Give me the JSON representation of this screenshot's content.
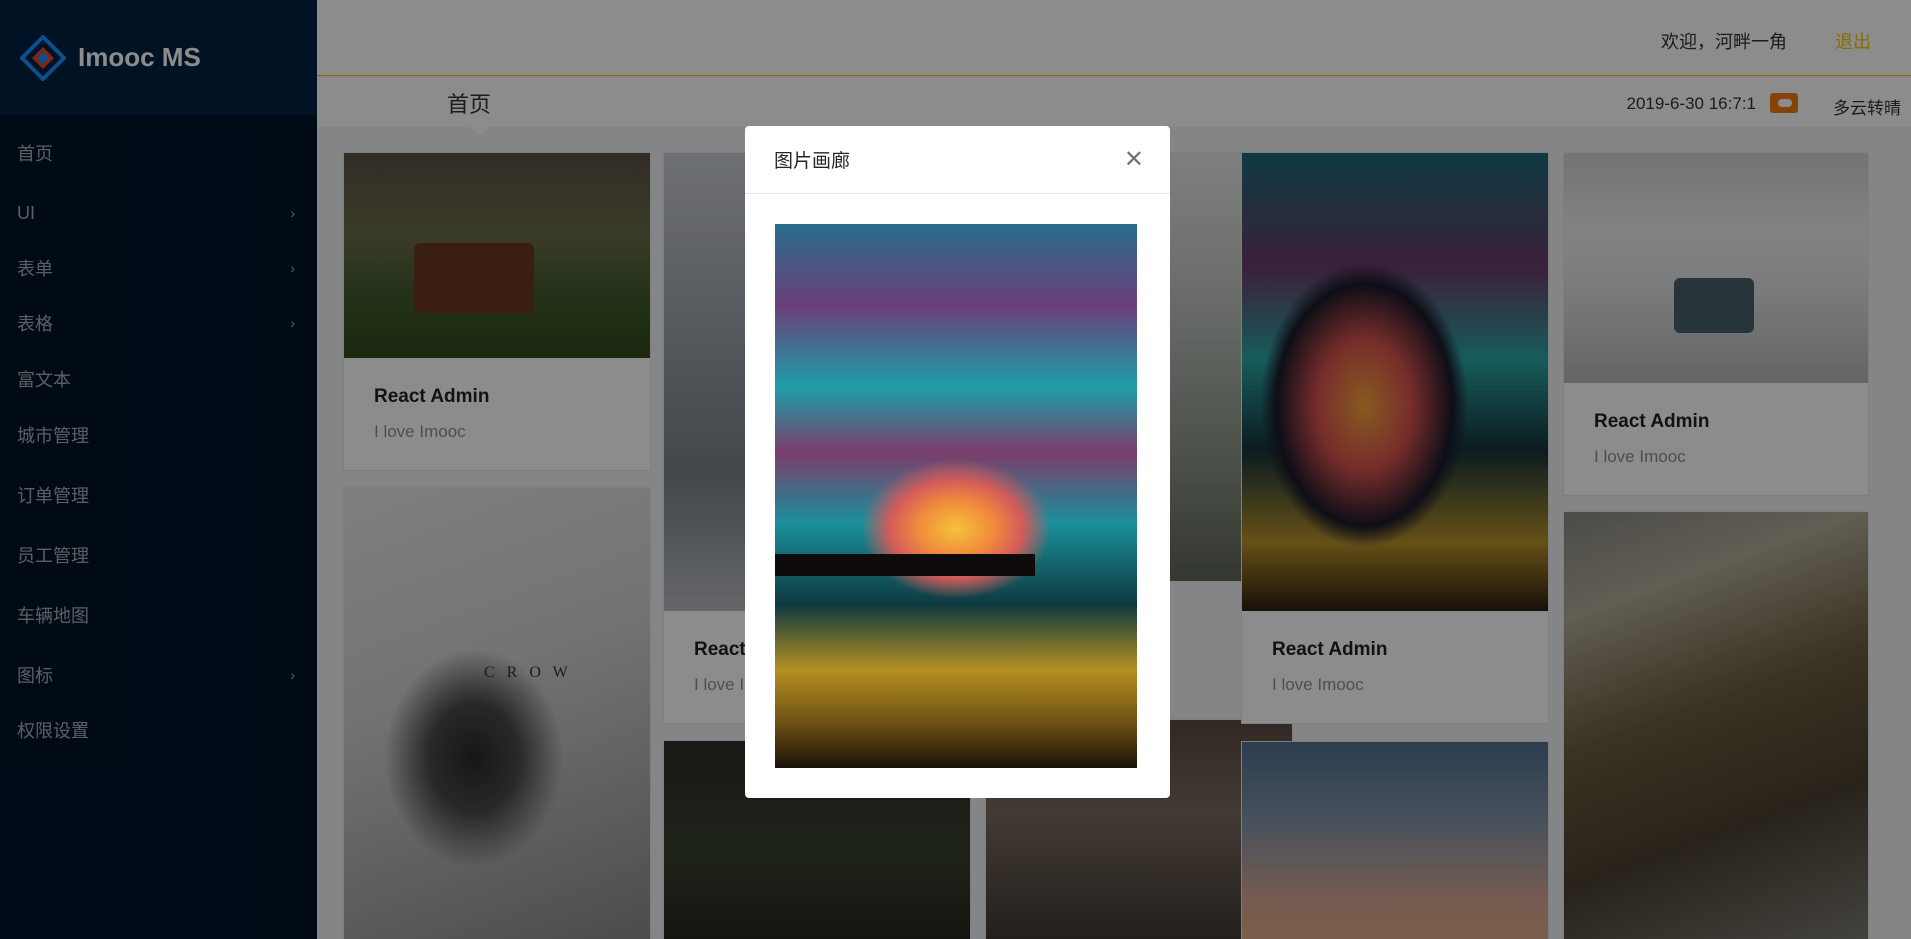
{
  "app": {
    "name": "Imooc MS"
  },
  "sidebar": {
    "items": [
      {
        "label": "首页",
        "has_submenu": false
      },
      {
        "label": "UI",
        "has_submenu": true
      },
      {
        "label": "表单",
        "has_submenu": true
      },
      {
        "label": "表格",
        "has_submenu": true
      },
      {
        "label": "富文本",
        "has_submenu": false
      },
      {
        "label": "城市管理",
        "has_submenu": false
      },
      {
        "label": "订单管理",
        "has_submenu": false
      },
      {
        "label": "员工管理",
        "has_submenu": false
      },
      {
        "label": "车辆地图",
        "has_submenu": false
      },
      {
        "label": "图标",
        "has_submenu": true
      },
      {
        "label": "权限设置",
        "has_submenu": false
      }
    ]
  },
  "header": {
    "welcome": "欢迎，河畔一角",
    "logout": "退出",
    "page_title": "首页",
    "datetime": "2019-6-30 16:7:1",
    "weather_icon": "cloudy-sunny-icon",
    "weather": "多云转晴"
  },
  "gallery": {
    "cards": [
      {
        "title": "React Admin",
        "desc": "I love Imooc"
      },
      {
        "title": "React",
        "desc": "I love I"
      },
      {
        "title": "React Admin",
        "desc": "I love Imooc"
      },
      {
        "title": "React Admin",
        "desc": "I love Imooc"
      }
    ],
    "crow_text": "C R O W"
  },
  "modal": {
    "title": "图片画廊",
    "close_icon": "close-icon"
  },
  "colors": {
    "sidebar_bg": "#001529",
    "accent": "#f9c700",
    "weather_icon": "#f57a12"
  }
}
